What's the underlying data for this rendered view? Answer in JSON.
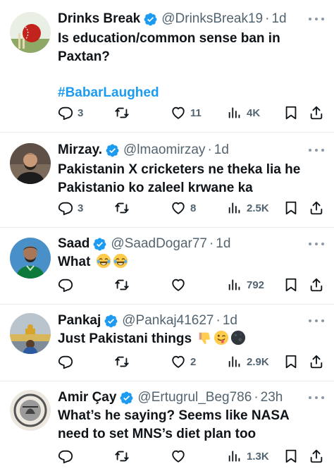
{
  "tweets": [
    {
      "name": "Drinks Break",
      "handle": "@DrinksBreak19",
      "dot": "·",
      "time": "1d",
      "text_lines": [
        "Is education/common sense ban in",
        "Paxtan?"
      ],
      "hashtag": "#BabarLaughed",
      "replies": "3",
      "retweets": "",
      "likes": "11",
      "views": "4K",
      "avatar": "cricket-ball-avatar"
    },
    {
      "name": "Mirzay.",
      "handle": "@lmaomirzay",
      "dot": "·",
      "time": "1d",
      "text_lines": [
        "Pakistanin X cricketers ne theka lia he",
        "Pakistanio ko zaleel krwane ka"
      ],
      "replies": "3",
      "retweets": "",
      "likes": "8",
      "views": "2.5K",
      "avatar": "man-portrait-avatar"
    },
    {
      "name": "Saad",
      "handle": "@SaadDogar77",
      "dot": "·",
      "time": "1d",
      "text_lines": [
        "What"
      ],
      "emojis": [
        "joy-emoji",
        "joy-emoji"
      ],
      "replies": "",
      "retweets": "",
      "likes": "",
      "views": "792",
      "avatar": "cricketer-avatar"
    },
    {
      "name": "Pankaj",
      "handle": "@Pankaj41627",
      "dot": "·",
      "time": "1d",
      "text_lines": [
        "Just Pakistani things"
      ],
      "emojis": [
        "thumbs-down-emoji",
        "winking-tongue-emoji",
        "new-moon-emoji"
      ],
      "replies": "",
      "retweets": "",
      "likes": "2",
      "views": "2.9K",
      "avatar": "golden-temple-avatar"
    },
    {
      "name": "Amir Çay",
      "handle": "@Ertugrul_Beg786",
      "dot": "·",
      "time": "23h",
      "text_lines": [
        "What’s he saying? Seems like NASA",
        "need to set MNS’s diet plan too"
      ],
      "replies": "",
      "retweets": "",
      "likes": "",
      "views": "1.3K",
      "avatar": "emblem-avatar"
    }
  ],
  "colors": {
    "accent": "#1d9bf0",
    "muted": "#536471",
    "text": "#0f1419",
    "divider": "#e6ecf0"
  }
}
